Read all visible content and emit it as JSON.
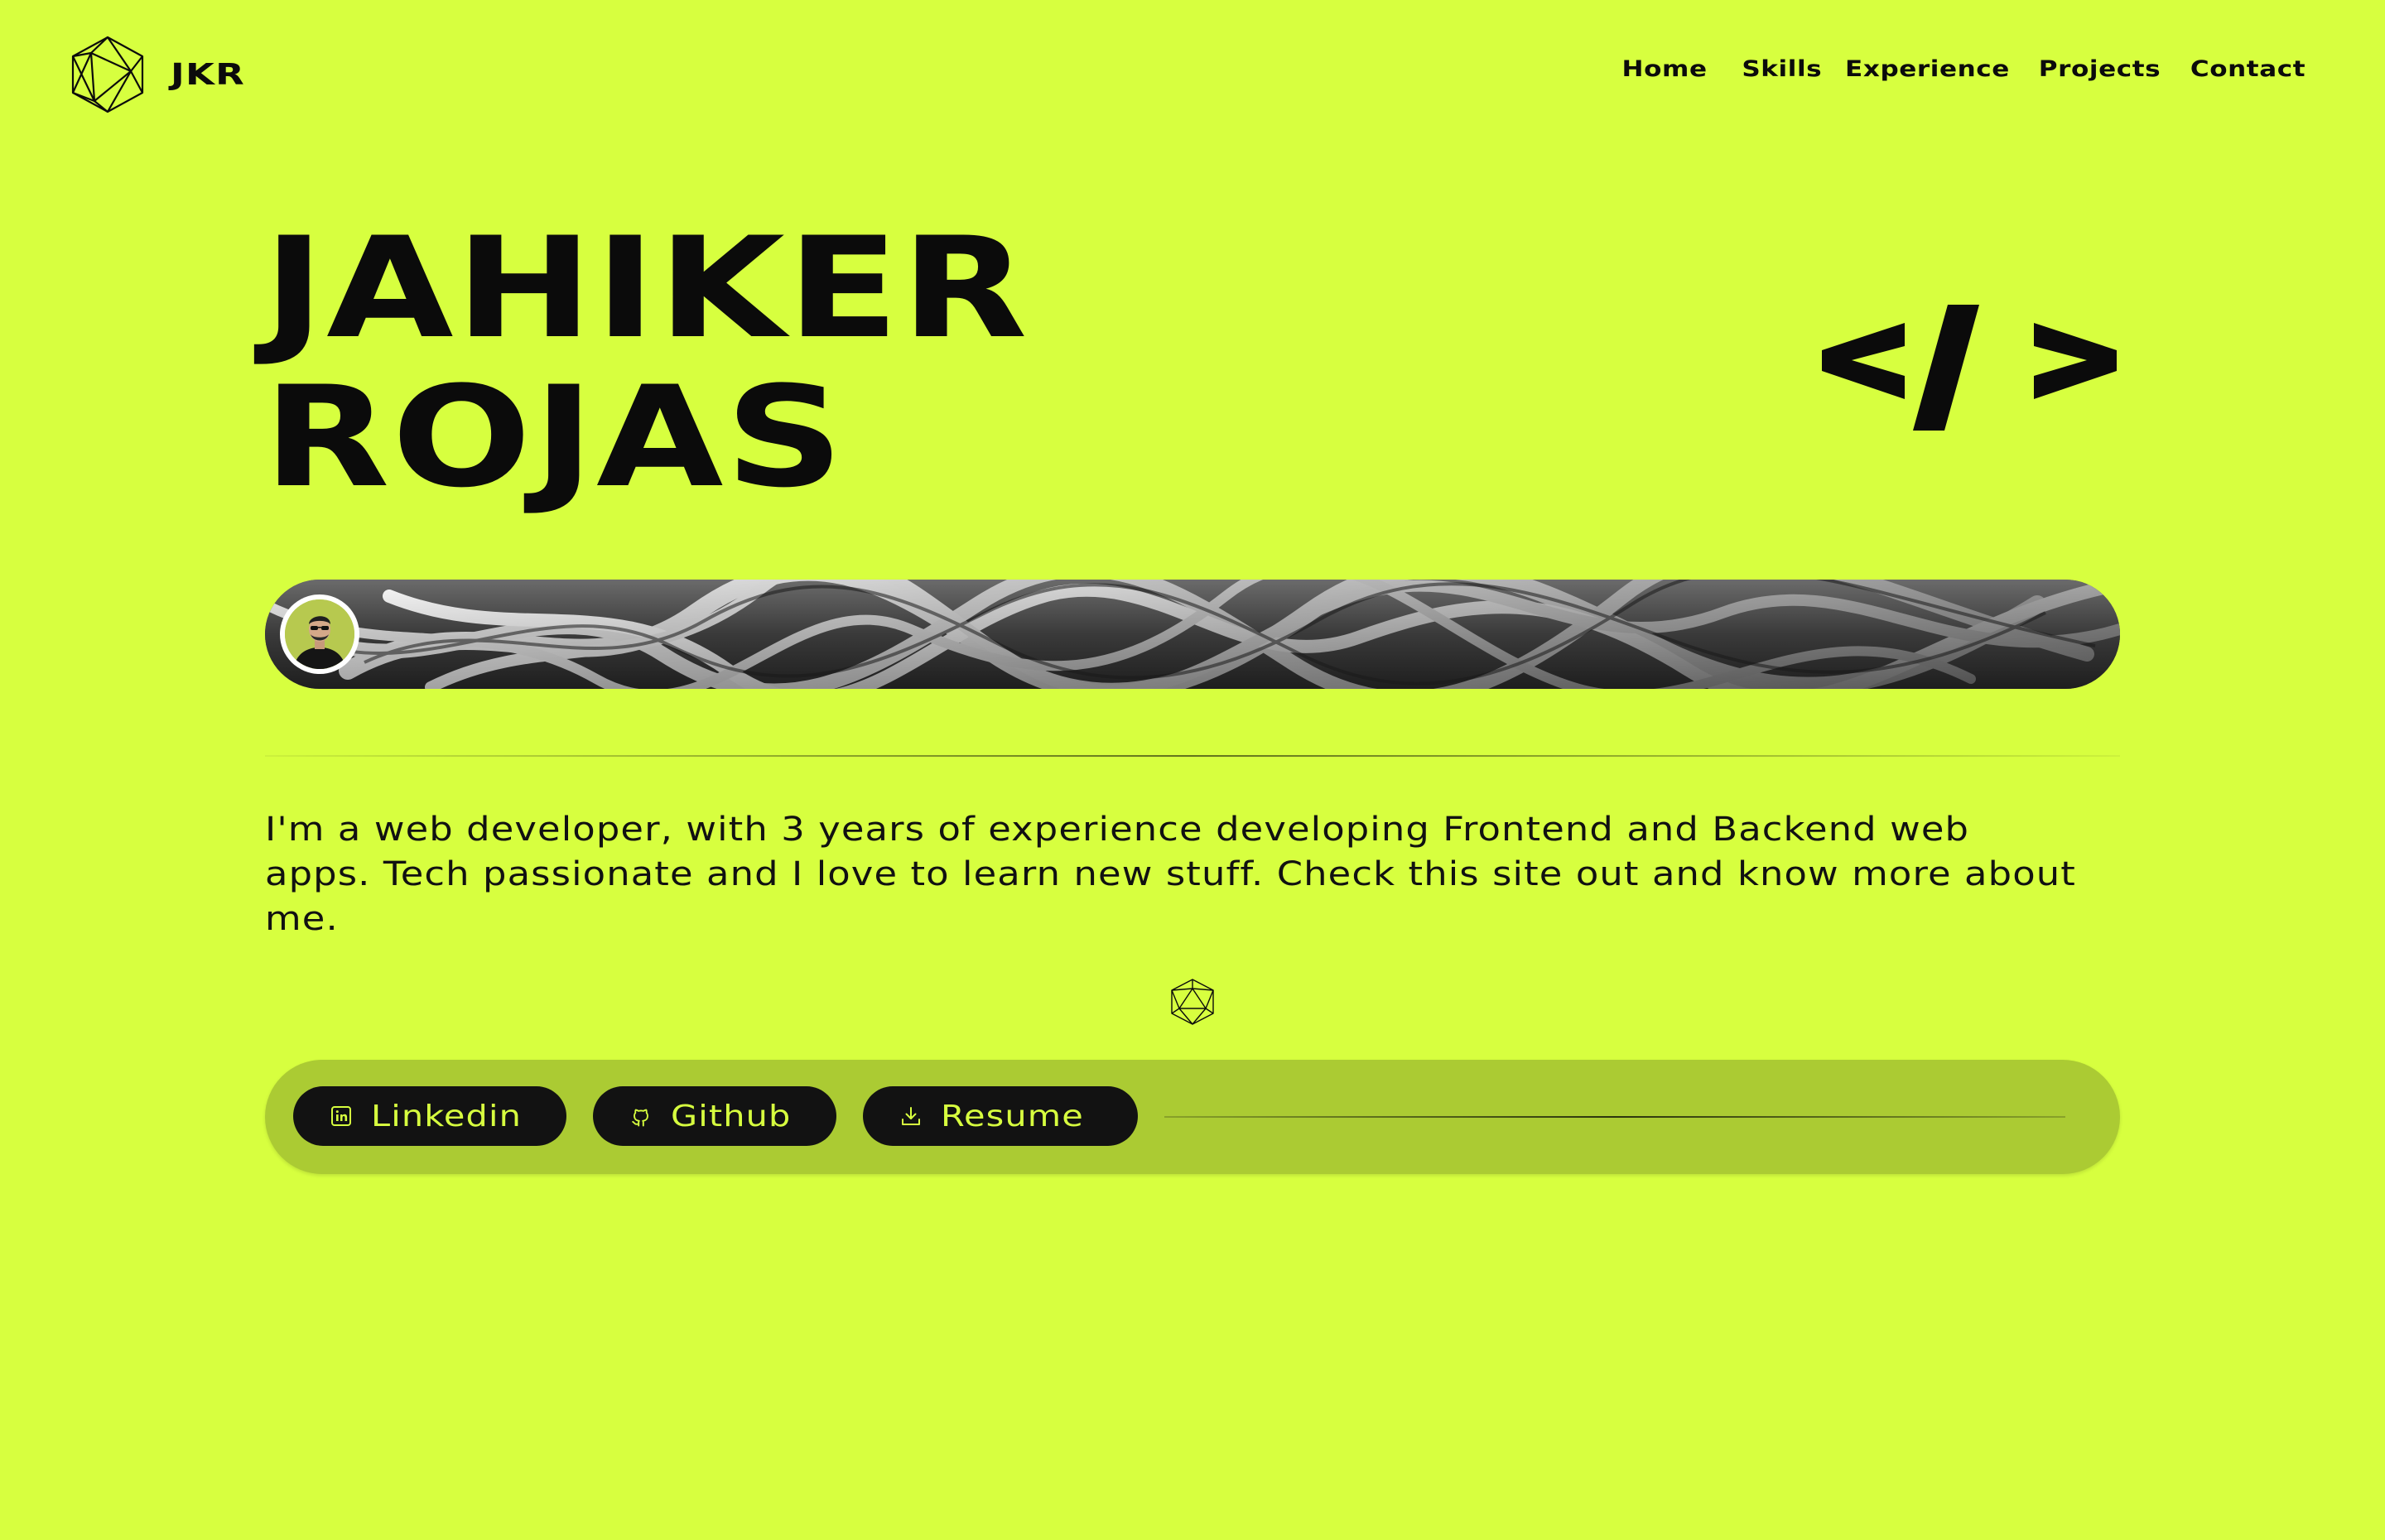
{
  "brand": {
    "name": "JKR",
    "icon": "polyhedron-logo-icon"
  },
  "nav": {
    "items": [
      {
        "label": "Home"
      },
      {
        "label": "Skills"
      },
      {
        "label": "Experience"
      },
      {
        "label": "Projects"
      },
      {
        "label": "Contact"
      }
    ]
  },
  "hero": {
    "first_name": "JAHIKER",
    "last_name": "ROJAS",
    "code_icon": "code-brackets-icon"
  },
  "banner": {
    "image": "abstract-3d-waves-image",
    "avatar": "profile-avatar"
  },
  "bio": {
    "text": "I'm a web developer, with 3 years of experience developing Frontend and Backend web apps. Tech passionate and I love to learn new stuff. Check this site out and know more about me."
  },
  "links": [
    {
      "label": "Linkedin",
      "icon": "linkedin-icon"
    },
    {
      "label": "Github",
      "icon": "github-icon"
    },
    {
      "label": "Resume",
      "icon": "download-icon"
    }
  ],
  "colors": {
    "background": "#d7ff3f",
    "bar": "#abcb33",
    "pill": "#121212",
    "text": "#0b0b0b"
  }
}
